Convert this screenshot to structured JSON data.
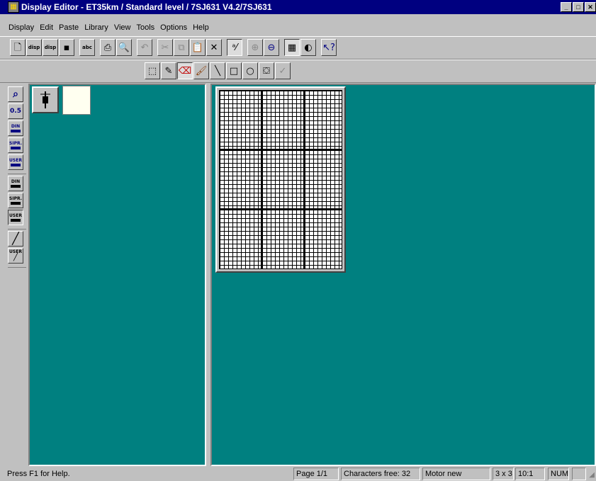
{
  "window": {
    "title": "Display Editor - ET35km / Standard level / 7SJ631 V4.2/7SJ631",
    "app_icon": "display-editor-icon"
  },
  "menu": [
    "Display",
    "Edit",
    "Paste",
    "Library",
    "View",
    "Tools",
    "Options",
    "Help"
  ],
  "toolbar_main": [
    {
      "icon": "new-document-icon"
    },
    {
      "icon": "import-display-icon",
      "label": "disp"
    },
    {
      "icon": "export-display-icon",
      "label": "disp"
    },
    {
      "icon": "save-icon"
    },
    {
      "icon": "spell-check-icon",
      "label": "abc"
    },
    {
      "icon": "print-icon"
    },
    {
      "icon": "print-preview-icon"
    },
    {
      "icon": "undo-icon"
    },
    {
      "icon": "cut-icon"
    },
    {
      "icon": "copy-icon"
    },
    {
      "icon": "paste-icon"
    },
    {
      "icon": "delete-icon"
    },
    {
      "icon": "text-tool-icon"
    },
    {
      "icon": "zoom-in-icon"
    },
    {
      "icon": "zoom-out-icon"
    },
    {
      "icon": "grid-toggle-icon"
    },
    {
      "icon": "contrast-icon"
    },
    {
      "icon": "context-help-icon"
    }
  ],
  "toolbar_draw": [
    {
      "icon": "select-rectangle-icon"
    },
    {
      "icon": "pencil-icon"
    },
    {
      "icon": "eraser-icon"
    },
    {
      "icon": "brush-icon"
    },
    {
      "icon": "line-icon"
    },
    {
      "icon": "rectangle-icon"
    },
    {
      "icon": "ellipse-icon"
    },
    {
      "icon": "fill-bucket-icon"
    },
    {
      "icon": "checkmark-icon"
    }
  ],
  "palette": [
    {
      "icon": "magnifier-icon"
    },
    {
      "icon": "zoom-level-icon",
      "label": "0.5"
    },
    {
      "icon": "din-symbol-icon",
      "label": "DIN"
    },
    {
      "icon": "sipr-symbol-icon",
      "label": "SIPR."
    },
    {
      "icon": "user-symbol-icon",
      "label": "USER"
    },
    {
      "icon": "din-switch-icon",
      "label": "DIN"
    },
    {
      "icon": "sipr-switch-icon",
      "label": "SIPR."
    },
    {
      "icon": "user-switch-icon",
      "label": "USER"
    },
    {
      "icon": "line-draw-icon"
    },
    {
      "icon": "user-line-icon",
      "label": "USER"
    }
  ],
  "library": {
    "symbol_icon": "breaker-symbol-icon"
  },
  "status": {
    "help": "Press F1 for Help.",
    "page": "Page 1/1",
    "chars": "Characters free: 32",
    "mode": "Motor new",
    "grid": "3 x 3",
    "ratio": "10:1",
    "num": "NUM"
  },
  "colors": {
    "workspace": "#008080",
    "titlebar": "#000080",
    "face": "#c0c0c0"
  }
}
